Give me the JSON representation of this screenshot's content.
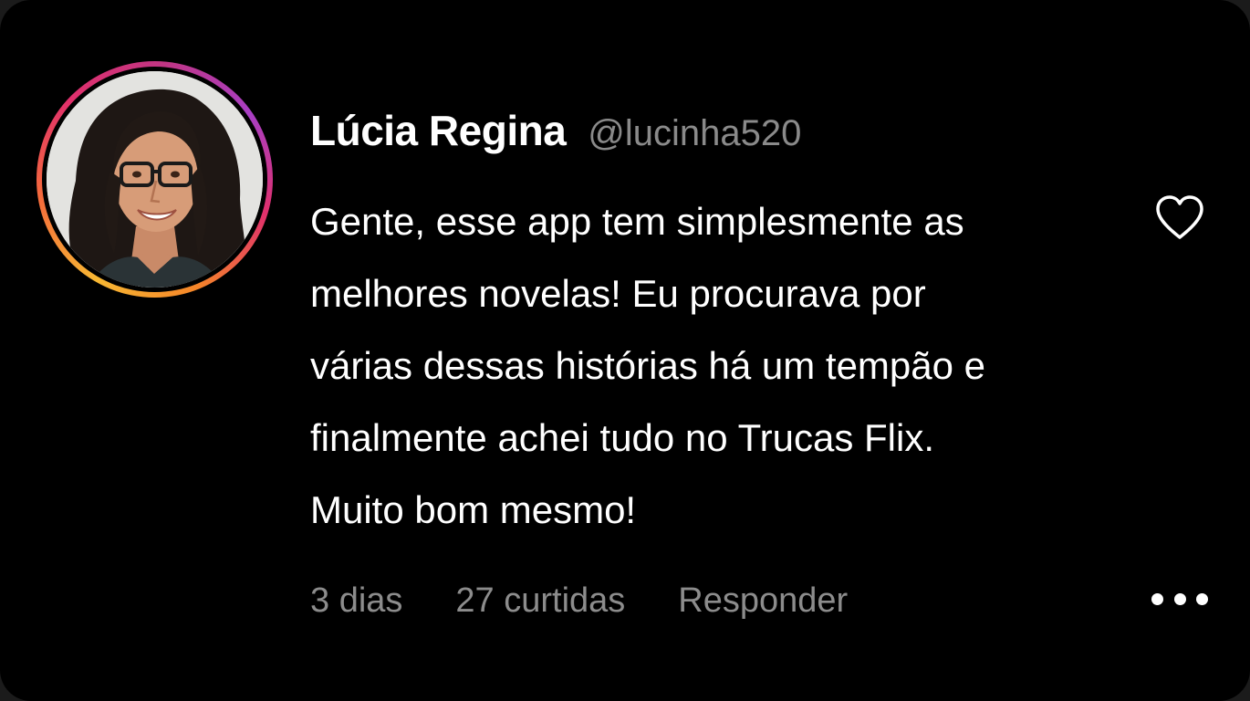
{
  "comment": {
    "author": {
      "display_name": "Lúcia Regina",
      "handle": "@lucinha520"
    },
    "body_lines": [
      "Gente, esse app tem simplesmente as",
      "melhores novelas! Eu procurava por",
      "várias dessas histórias há um tempão e",
      "finalmente achei tudo no Trucas Flix.",
      "Muito bom mesmo!"
    ],
    "meta": {
      "time_ago": "3 dias",
      "likes": "27 curtidas",
      "reply_label": "Responder"
    },
    "icons": {
      "like": "heart-outline-icon",
      "more": "more-horizontal-icon"
    },
    "colors": {
      "background": "#000000",
      "text_primary": "#ffffff",
      "text_secondary": "#8a8a8a",
      "story_ring_gradient": [
        "#f7b733",
        "#f56a3c",
        "#e1306c",
        "#c13584",
        "#a83fc4"
      ]
    }
  }
}
